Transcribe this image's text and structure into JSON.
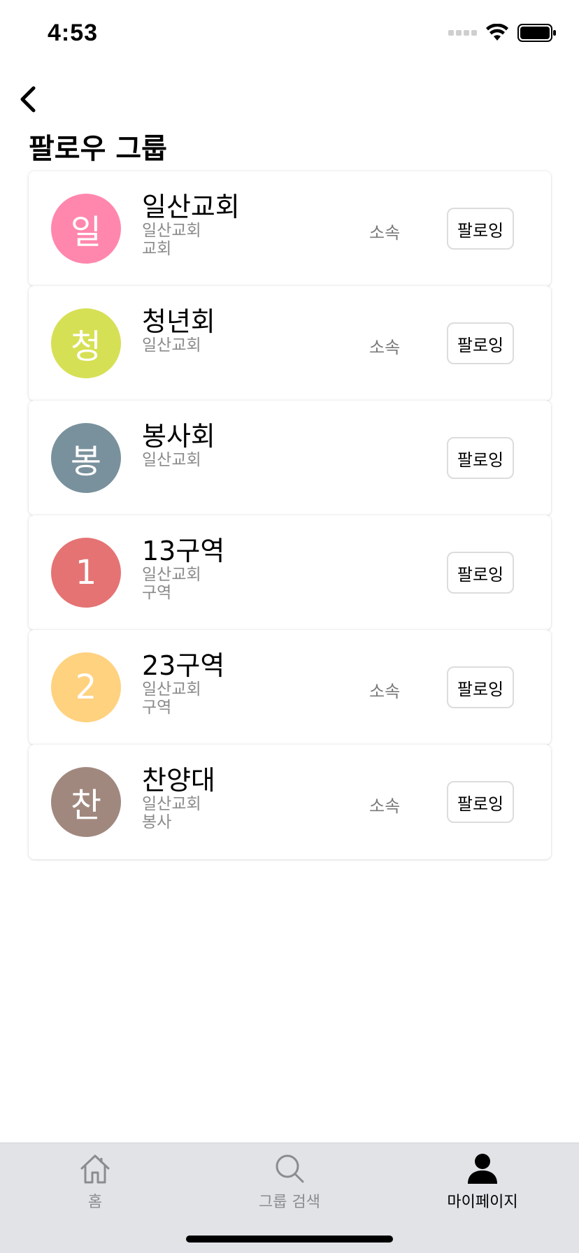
{
  "status_bar": {
    "time": "4:53"
  },
  "page": {
    "title": "팔로우 그룹"
  },
  "groups": [
    {
      "avatar": "일",
      "color": "#ff87ad",
      "name": "일산교회",
      "sub1": "일산교회",
      "sub2": "교회",
      "membership": "소속",
      "follow_label": "팔로잉"
    },
    {
      "avatar": "청",
      "color": "#d6e055",
      "name": "청년회",
      "sub1": "일산교회",
      "sub2": "",
      "membership": "소속",
      "follow_label": "팔로잉"
    },
    {
      "avatar": "봉",
      "color": "#79919c",
      "name": "봉사회",
      "sub1": "일산교회",
      "sub2": "",
      "membership": "",
      "follow_label": "팔로잉"
    },
    {
      "avatar": "1",
      "color": "#e57373",
      "name": "13구역",
      "sub1": "일산교회",
      "sub2": "구역",
      "membership": "",
      "follow_label": "팔로잉"
    },
    {
      "avatar": "2",
      "color": "#ffd280",
      "name": "23구역",
      "sub1": "일산교회",
      "sub2": "구역",
      "membership": "소속",
      "follow_label": "팔로잉"
    },
    {
      "avatar": "찬",
      "color": "#a1887f",
      "name": "찬양대",
      "sub1": "일산교회",
      "sub2": "봉사",
      "membership": "소속",
      "follow_label": "팔로잉"
    }
  ],
  "tab_bar": {
    "home_label": "홈",
    "search_label": "그룹 검색",
    "mypage_label": "마이페이지"
  }
}
